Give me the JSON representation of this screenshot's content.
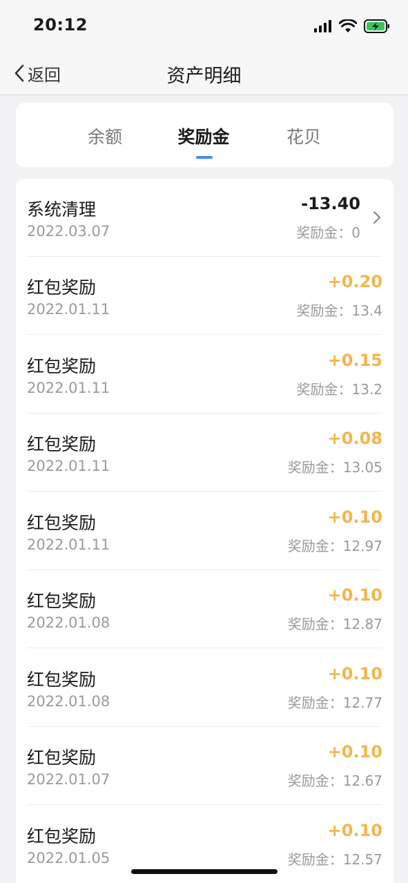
{
  "status_bar": {
    "time": "20:12",
    "icons": [
      "cellular-signal-icon",
      "wifi-icon",
      "battery-charging-icon"
    ],
    "battery_color": "#34c759"
  },
  "nav": {
    "back_label": "返回",
    "title": "资产明细"
  },
  "tabs": [
    {
      "label": "余额",
      "active": false
    },
    {
      "label": "奖励金",
      "active": true
    },
    {
      "label": "花贝",
      "active": false
    }
  ],
  "accent_color": "#3d8ff0",
  "amount_positive_color": "#f3b64a",
  "records": [
    {
      "title": "系统清理",
      "date": "2022.03.07",
      "amount": "-13.40",
      "balance": "奖励金：0",
      "has_chevron": true
    },
    {
      "title": "红包奖励",
      "date": "2022.01.11",
      "amount": "+0.20",
      "balance": "奖励金：13.4"
    },
    {
      "title": "红包奖励",
      "date": "2022.01.11",
      "amount": "+0.15",
      "balance": "奖励金：13.2"
    },
    {
      "title": "红包奖励",
      "date": "2022.01.11",
      "amount": "+0.08",
      "balance": "奖励金：13.05"
    },
    {
      "title": "红包奖励",
      "date": "2022.01.11",
      "amount": "+0.10",
      "balance": "奖励金：12.97"
    },
    {
      "title": "红包奖励",
      "date": "2022.01.08",
      "amount": "+0.10",
      "balance": "奖励金：12.87"
    },
    {
      "title": "红包奖励",
      "date": "2022.01.08",
      "amount": "+0.10",
      "balance": "奖励金：12.77"
    },
    {
      "title": "红包奖励",
      "date": "2022.01.07",
      "amount": "+0.10",
      "balance": "奖励金：12.67"
    },
    {
      "title": "红包奖励",
      "date": "2022.01.05",
      "amount": "+0.10",
      "balance": "奖励金：12.57"
    }
  ]
}
